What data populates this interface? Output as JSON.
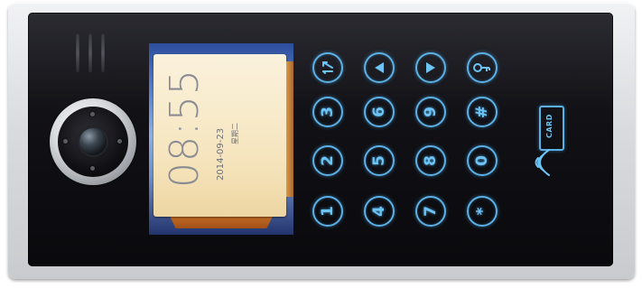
{
  "device": {
    "accent_color": "#5bb0e6",
    "screen": {
      "time": "08:55",
      "date": "2014-09-23",
      "weekday": "星期二"
    },
    "keypad": [
      {
        "id": "key-1",
        "label": "1"
      },
      {
        "id": "key-2",
        "label": "2"
      },
      {
        "id": "key-3",
        "label": "3"
      },
      {
        "id": "key-4",
        "label": "4"
      },
      {
        "id": "key-5",
        "label": "5"
      },
      {
        "id": "key-6",
        "label": "6"
      },
      {
        "id": "key-7",
        "label": "7"
      },
      {
        "id": "key-8",
        "label": "8"
      },
      {
        "id": "key-9",
        "label": "9"
      },
      {
        "id": "key-0",
        "label": "0"
      },
      {
        "id": "key-star",
        "label": "*"
      },
      {
        "id": "key-hash",
        "label": "#"
      }
    ],
    "function_keys": [
      {
        "id": "key-call-manager",
        "icon": "call-manager-icon",
        "label": "1↗"
      },
      {
        "id": "key-left",
        "icon": "arrow-left-icon"
      },
      {
        "id": "key-right",
        "icon": "arrow-right-icon"
      },
      {
        "id": "key-unlock",
        "icon": "key-icon"
      }
    ],
    "card_reader": {
      "label": "CARD",
      "icon": "rfid-wave-icon"
    }
  }
}
